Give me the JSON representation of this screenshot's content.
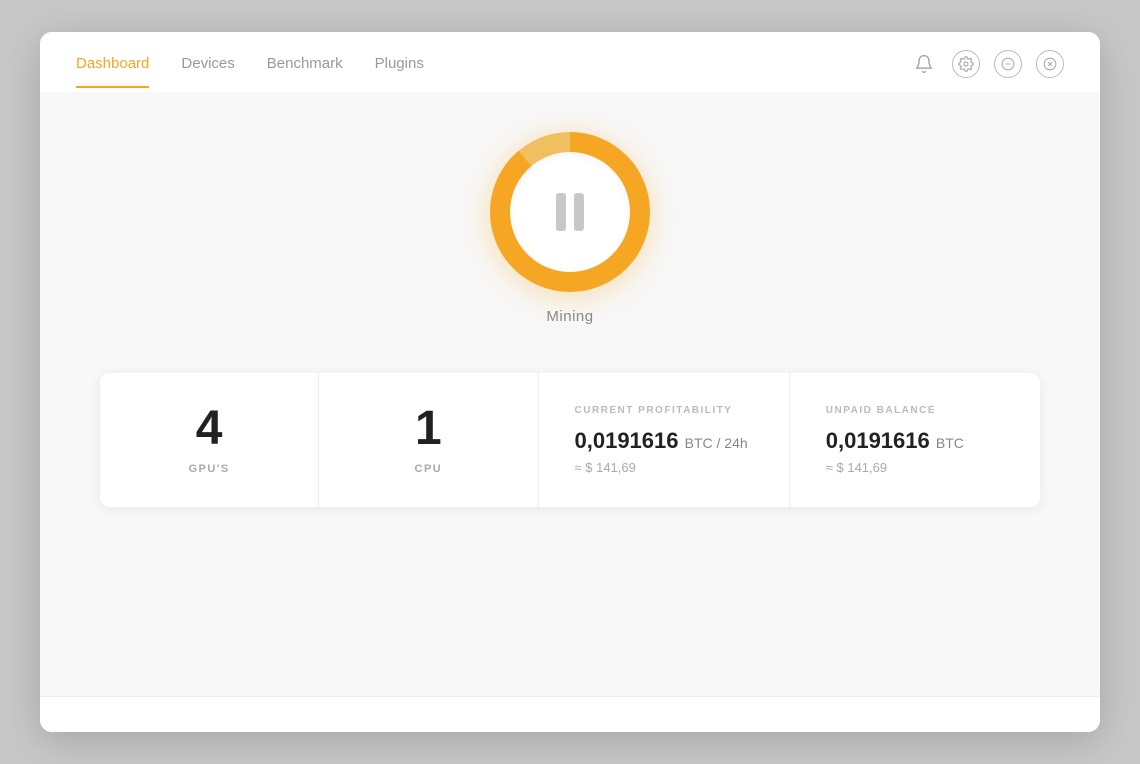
{
  "header": {
    "tabs": [
      {
        "id": "dashboard",
        "label": "Dashboard",
        "active": true
      },
      {
        "id": "devices",
        "label": "Devices",
        "active": false
      },
      {
        "id": "benchmark",
        "label": "Benchmark",
        "active": false
      },
      {
        "id": "plugins",
        "label": "Plugins",
        "active": false
      }
    ],
    "icons": [
      {
        "id": "bell",
        "symbol": "🔔"
      },
      {
        "id": "settings",
        "symbol": "⚙"
      },
      {
        "id": "minimize",
        "symbol": "−"
      },
      {
        "id": "close",
        "symbol": "✕"
      }
    ]
  },
  "mining": {
    "status_label": "Mining",
    "button_state": "paused"
  },
  "stats": {
    "gpus": {
      "value": "4",
      "label": "GPU'S"
    },
    "cpu": {
      "value": "1",
      "label": "CPU"
    },
    "profitability": {
      "section_label": "CURRENT PROFITABILITY",
      "btc_value": "0,0191616",
      "btc_unit": "BTC / 24h",
      "usd_approx": "≈ $ 141,69"
    },
    "balance": {
      "section_label": "UNPAID BALANCE",
      "btc_value": "0,0191616",
      "btc_unit": "BTC",
      "usd_approx": "≈ $ 141,69"
    }
  },
  "bottom": {
    "hint": ""
  }
}
